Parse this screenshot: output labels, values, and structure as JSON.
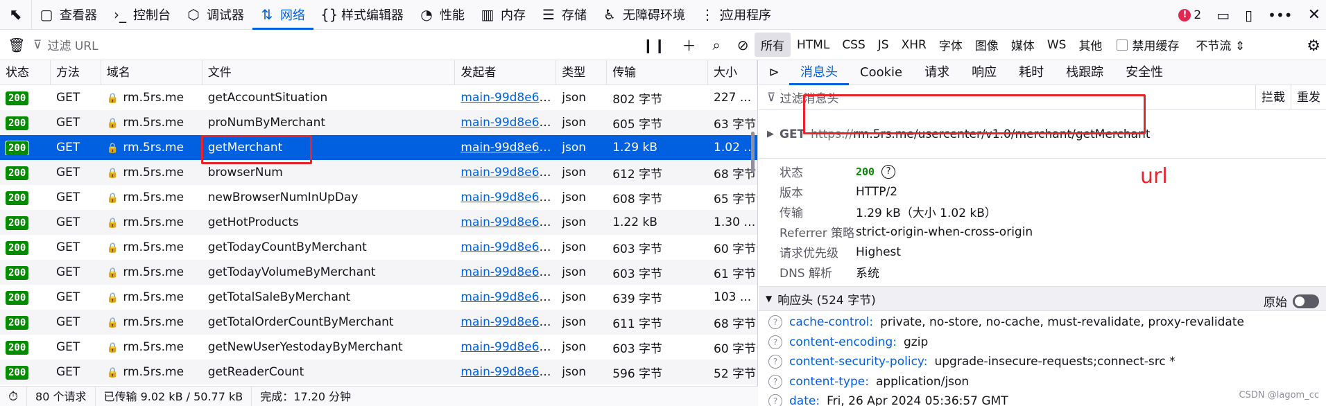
{
  "toolbar": {
    "tabs": [
      {
        "icon": "▢",
        "label": "查看器"
      },
      {
        "icon": "›_",
        "label": "控制台"
      },
      {
        "icon": "⬡",
        "label": "调试器"
      },
      {
        "icon": "⇅",
        "label": "网络"
      },
      {
        "icon": "{}",
        "label": "样式编辑器"
      },
      {
        "icon": "◔",
        "label": "性能"
      },
      {
        "icon": "▥",
        "label": "内存"
      },
      {
        "icon": "☰",
        "label": "存储"
      },
      {
        "icon": "♿",
        "label": "无障碍环境"
      },
      {
        "icon": "⋮⋮",
        "label": "应用程序"
      }
    ],
    "error_count": "2"
  },
  "filterbar": {
    "placeholder": "过滤 URL",
    "types": [
      "所有",
      "HTML",
      "CSS",
      "JS",
      "XHR",
      "字体",
      "图像",
      "媒体",
      "WS",
      "其他"
    ],
    "disable_cache": "禁用缓存",
    "throttle": "不节流 ⇕"
  },
  "table": {
    "headers": [
      "状态",
      "方法",
      "域名",
      "文件",
      "发起者",
      "类型",
      "传输",
      "大小"
    ],
    "rows": [
      {
        "status": "200",
        "method": "GET",
        "domain": "rm.5rs.me",
        "file": "getAccountSituation",
        "initiator": "main-99d8e67...",
        "type": "json",
        "transferred": "802 字节",
        "size": "227 ..."
      },
      {
        "status": "200",
        "method": "GET",
        "domain": "rm.5rs.me",
        "file": "proNumByMerchant",
        "initiator": "main-99d8e67...",
        "type": "json",
        "transferred": "605 字节",
        "size": "63 字节"
      },
      {
        "status": "200",
        "method": "GET",
        "domain": "rm.5rs.me",
        "file": "getMerchant",
        "initiator": "main-99d8e67...",
        "type": "json",
        "transferred": "1.29 kB",
        "size": "1.02 kB"
      },
      {
        "status": "200",
        "method": "GET",
        "domain": "rm.5rs.me",
        "file": "browserNum",
        "initiator": "main-99d8e67...",
        "type": "json",
        "transferred": "612 字节",
        "size": "68 字节"
      },
      {
        "status": "200",
        "method": "GET",
        "domain": "rm.5rs.me",
        "file": "newBrowserNumInUpDay",
        "initiator": "main-99d8e67...",
        "type": "json",
        "transferred": "608 字节",
        "size": "65 字节"
      },
      {
        "status": "200",
        "method": "GET",
        "domain": "rm.5rs.me",
        "file": "getHotProducts",
        "initiator": "main-99d8e67...",
        "type": "json",
        "transferred": "1.22 kB",
        "size": "1.30 kB"
      },
      {
        "status": "200",
        "method": "GET",
        "domain": "rm.5rs.me",
        "file": "getTodayCountByMerchant",
        "initiator": "main-99d8e67...",
        "type": "json",
        "transferred": "603 字节",
        "size": "60 字节"
      },
      {
        "status": "200",
        "method": "GET",
        "domain": "rm.5rs.me",
        "file": "getTodayVolumeByMerchant",
        "initiator": "main-99d8e67...",
        "type": "json",
        "transferred": "603 字节",
        "size": "61 字节"
      },
      {
        "status": "200",
        "method": "GET",
        "domain": "rm.5rs.me",
        "file": "getTotalSaleByMerchant",
        "initiator": "main-99d8e67...",
        "type": "json",
        "transferred": "639 字节",
        "size": "103 ..."
      },
      {
        "status": "200",
        "method": "GET",
        "domain": "rm.5rs.me",
        "file": "getTotalOrderCountByMerchant",
        "initiator": "main-99d8e67...",
        "type": "json",
        "transferred": "611 字节",
        "size": "68 字节"
      },
      {
        "status": "200",
        "method": "GET",
        "domain": "rm.5rs.me",
        "file": "getNewUserYestodayByMerchant",
        "initiator": "main-99d8e67...",
        "type": "json",
        "transferred": "603 字节",
        "size": "60 字节"
      },
      {
        "status": "200",
        "method": "GET",
        "domain": "rm.5rs.me",
        "file": "getReaderCount",
        "initiator": "main-99d8e67...",
        "type": "json",
        "transferred": "596 字节",
        "size": "52 字节"
      }
    ],
    "selected_index": 2
  },
  "statusbar": {
    "requests": "80 个请求",
    "transferred": "已传输 9.02 kB / 50.77 kB",
    "finish": "完成：17.20 分钟"
  },
  "details": {
    "tabs": [
      "消息头",
      "Cookie",
      "请求",
      "响应",
      "耗时",
      "栈跟踪",
      "安全性"
    ],
    "filter_placeholder": "过滤消息头",
    "block_label": "拦截",
    "resend_label": "重发",
    "method": "GET",
    "url_proto": "https://",
    "url_rest": "rm.5rs.me/usercenter/v1.0/merchant/getMerchant",
    "annotation": "url",
    "info": [
      {
        "key": "状态",
        "value": "200"
      },
      {
        "key": "版本",
        "value": "HTTP/2"
      },
      {
        "key": "传输",
        "value": "1.29 kB（大小 1.02 kB）"
      },
      {
        "key": "Referrer 策略",
        "value": "strict-origin-when-cross-origin"
      },
      {
        "key": "请求优先级",
        "value": "Highest"
      },
      {
        "key": "DNS 解析",
        "value": "系统"
      }
    ],
    "response_headers_title": "响应头 (524 字节)",
    "raw_label": "原始",
    "response_headers": [
      {
        "name": "cache-control:",
        "value": "private, no-store, no-cache, must-revalidate, proxy-revalidate"
      },
      {
        "name": "content-encoding:",
        "value": "gzip"
      },
      {
        "name": "content-security-policy:",
        "value": "upgrade-insecure-requests;connect-src *"
      },
      {
        "name": "content-type:",
        "value": "application/json"
      },
      {
        "name": "date:",
        "value": "Fri, 26 Apr 2024 05:36:57 GMT"
      }
    ]
  },
  "watermark": "CSDN @lagom_cc"
}
